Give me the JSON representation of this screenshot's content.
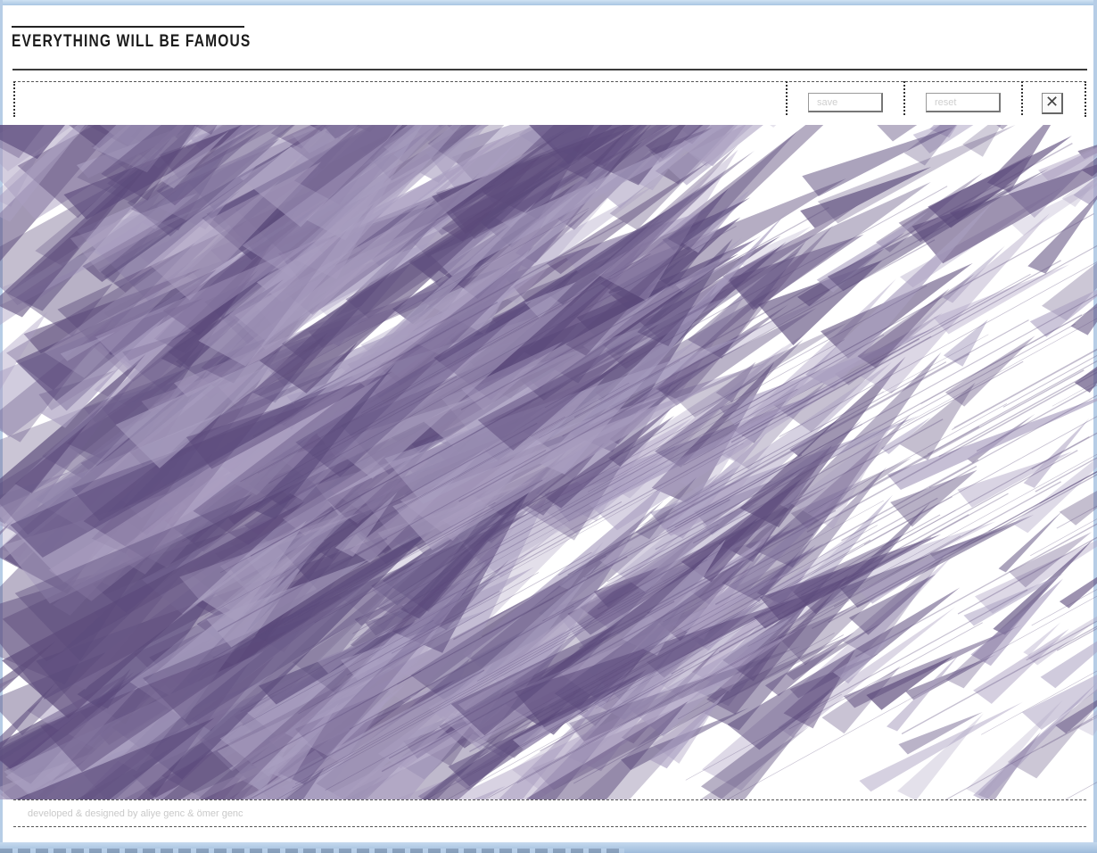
{
  "header": {
    "title": "EVERYTHING WILL BE FAMOUS"
  },
  "toolbar": {
    "save_label": "save",
    "reset_label": "reset",
    "close_icon": "close-icon",
    "close_glyph": "✕"
  },
  "artwork": {
    "fill_color": "#5b4a7b",
    "fill_color_light": "#a99ec0"
  },
  "footer": {
    "credits": "developed & designed by aliye genc & ömer genc"
  }
}
